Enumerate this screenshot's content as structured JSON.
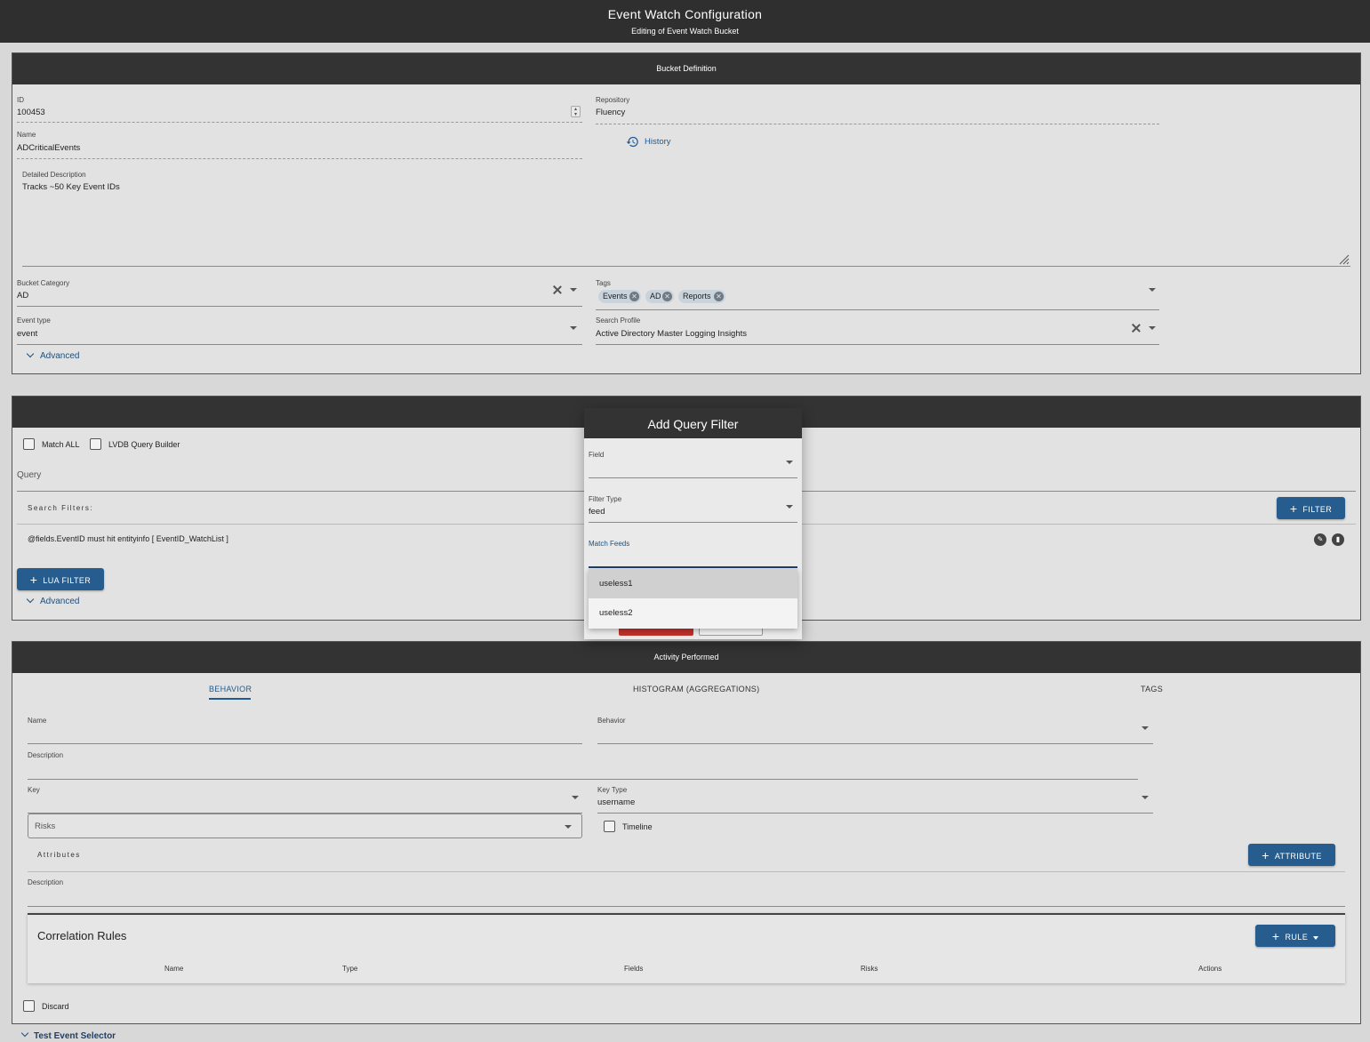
{
  "header": {
    "title": "Event Watch Configuration",
    "subtitle": "Editing of Event Watch Bucket"
  },
  "bucket": {
    "heading": "Bucket Definition",
    "id_label": "ID",
    "id_value": "100453",
    "repo_label": "Repository",
    "repo_value": "Fluency",
    "name_label": "Name",
    "name_value": "ADCriticalEvents",
    "history_label": "History",
    "desc_label": "Detailed Description",
    "desc_value": "Tracks ~50 Key Event IDs",
    "category_label": "Bucket Category",
    "category_value": "AD",
    "tags_label": "Tags",
    "tags": [
      "Events",
      "AD",
      "Reports"
    ],
    "event_type_label": "Event type",
    "event_type_value": "event",
    "search_profile_label": "Search Profile",
    "search_profile_value": "Active Directory Master Logging Insights",
    "advanced_label": "Advanced"
  },
  "query": {
    "match_all_label": "Match ALL",
    "lvdb_label": "LVDB Query Builder",
    "query_label": "Query",
    "search_filters_label": "Search Filters:",
    "filter_button": "FILTER",
    "filter_row": "@fields.EventID must hit entityinfo [ EventID_WatchList ]",
    "lua_filter_button": "LUA FILTER",
    "advanced_label": "Advanced"
  },
  "dialog": {
    "title": "Add Query Filter",
    "field_label": "Field",
    "filter_type_label": "Filter Type",
    "filter_type_value": "feed",
    "match_feeds_label": "Match Feeds",
    "options": [
      "useless1",
      "useless2"
    ]
  },
  "activity": {
    "heading": "Activity Performed",
    "tabs": [
      "BEHAVIOR",
      "HISTOGRAM (AGGREGATIONS)",
      "TAGS"
    ],
    "name_label": "Name",
    "behavior_label": "Behavior",
    "description_label": "Description",
    "key_label": "Key",
    "key_type_label": "Key Type",
    "key_type_value": "username",
    "risks_placeholder": "Risks",
    "timeline_label": "Timeline",
    "attributes_label": "Attributes",
    "attribute_button": "ATTRIBUTE",
    "attr_description_label": "Description",
    "correlation_title": "Correlation Rules",
    "rule_button": "RULE",
    "columns": [
      "Name",
      "Type",
      "Fields",
      "Risks",
      "Actions"
    ],
    "discard_label": "Discard"
  },
  "footer": {
    "test_event_selector": "Test Event Selector"
  },
  "colors": {
    "header_bg": "#2f2f2f",
    "accent": "#265d8e",
    "link": "#1f5a91"
  }
}
